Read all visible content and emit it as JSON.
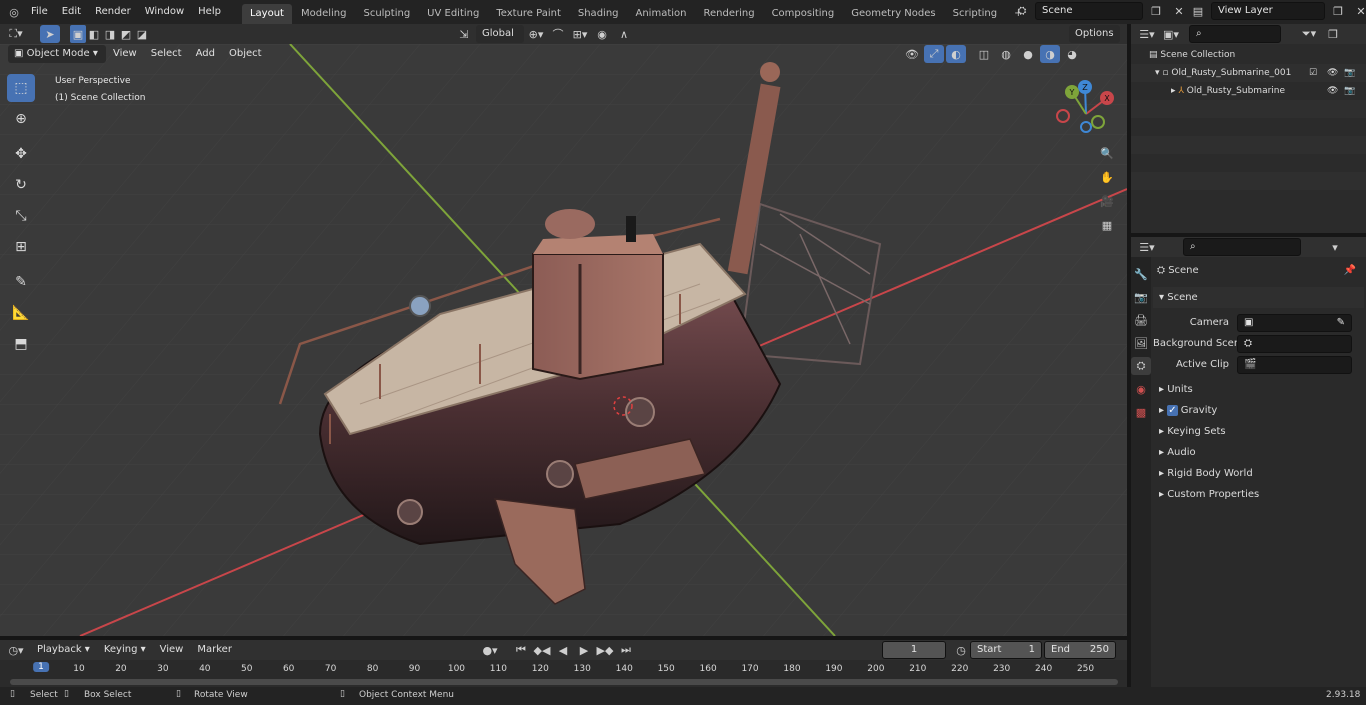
{
  "menus": [
    "File",
    "Edit",
    "Render",
    "Window",
    "Help"
  ],
  "workspaces": [
    "Layout",
    "Modeling",
    "Sculpting",
    "UV Editing",
    "Texture Paint",
    "Shading",
    "Animation",
    "Rendering",
    "Compositing",
    "Geometry Nodes",
    "Scripting"
  ],
  "active_workspace": "Layout",
  "scene_name": "Scene",
  "view_layer": "View Layer",
  "viewport": {
    "mode": "Object Mode",
    "menus": [
      "View",
      "Select",
      "Add",
      "Object"
    ],
    "transform": "Global",
    "options": "Options",
    "overlay_line1": "User Perspective",
    "overlay_line2": "(1) Scene Collection",
    "gizmo": {
      "x": "X",
      "y": "Y",
      "z": "Z"
    }
  },
  "outliner": {
    "root": "Scene Collection",
    "items": [
      {
        "label": "Old_Rusty_Submarine_001"
      },
      {
        "label": "Old_Rusty_Submarine"
      }
    ]
  },
  "properties": {
    "context": "Scene",
    "section": "Scene",
    "fields": [
      {
        "label": "Camera"
      },
      {
        "label": "Background Scene"
      },
      {
        "label": "Active Clip"
      }
    ],
    "panels": [
      "Units",
      "Gravity",
      "Keying Sets",
      "Audio",
      "Rigid Body World",
      "Custom Properties"
    ]
  },
  "timeline": {
    "menus": [
      "Playback",
      "Keying",
      "View",
      "Marker"
    ],
    "current_frame": "1",
    "start_label": "Start",
    "start": "1",
    "end_label": "End",
    "end": "250",
    "ticks": [
      "1",
      "10",
      "20",
      "30",
      "40",
      "50",
      "60",
      "70",
      "80",
      "90",
      "100",
      "110",
      "120",
      "130",
      "140",
      "150",
      "160",
      "170",
      "180",
      "190",
      "200",
      "210",
      "220",
      "230",
      "240",
      "250"
    ]
  },
  "status": {
    "select": "Select",
    "box_select": "Box Select",
    "rotate": "Rotate View",
    "context_menu": "Object Context Menu",
    "version": "2.93.18"
  },
  "colors": {
    "accent": "#4772b3",
    "x_axis": "#c8464a",
    "y_axis": "#7ea43a",
    "z_axis": "#3f88d6"
  }
}
